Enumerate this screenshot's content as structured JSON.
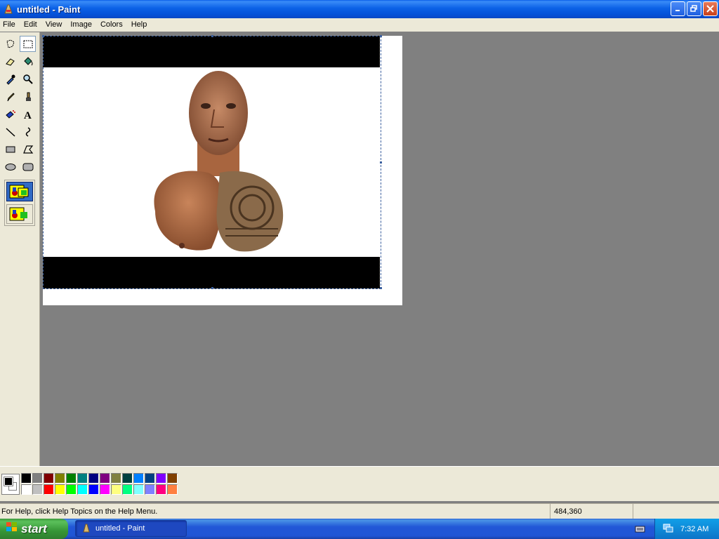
{
  "window": {
    "title": "untitled - Paint",
    "icon": "paint-icon"
  },
  "menu": [
    "File",
    "Edit",
    "View",
    "Image",
    "Colors",
    "Help"
  ],
  "tools": [
    {
      "name": "free-form-select",
      "icon": "free-select-icon"
    },
    {
      "name": "select",
      "icon": "rect-select-icon",
      "active": true
    },
    {
      "name": "eraser",
      "icon": "eraser-icon"
    },
    {
      "name": "fill-with-color",
      "icon": "fill-bucket-icon"
    },
    {
      "name": "pick-color",
      "icon": "eyedropper-icon"
    },
    {
      "name": "magnifier",
      "icon": "magnifier-icon"
    },
    {
      "name": "pencil",
      "icon": "pencil-icon"
    },
    {
      "name": "brush",
      "icon": "brush-icon"
    },
    {
      "name": "airbrush",
      "icon": "airbrush-icon"
    },
    {
      "name": "text",
      "icon": "text-icon"
    },
    {
      "name": "line",
      "icon": "line-icon"
    },
    {
      "name": "curve",
      "icon": "curve-icon"
    },
    {
      "name": "rectangle",
      "icon": "rectangle-icon"
    },
    {
      "name": "polygon",
      "icon": "polygon-icon"
    },
    {
      "name": "ellipse",
      "icon": "ellipse-icon"
    },
    {
      "name": "rounded-rectangle",
      "icon": "rounded-rect-icon"
    }
  ],
  "palette": {
    "foreground": "#000000",
    "background": "#ffffff",
    "colors": [
      "#000000",
      "#808080",
      "#800000",
      "#808000",
      "#008000",
      "#008080",
      "#000080",
      "#800080",
      "#808040",
      "#004040",
      "#0080ff",
      "#004080",
      "#8000ff",
      "#804000",
      "#ffffff",
      "#c0c0c0",
      "#ff0000",
      "#ffff00",
      "#00ff00",
      "#00ffff",
      "#0000ff",
      "#ff00ff",
      "#ffff80",
      "#00ff80",
      "#80ffff",
      "#8080ff",
      "#ff0080",
      "#ff8040"
    ]
  },
  "status": {
    "help_text": "For Help, click Help Topics on the Help Menu.",
    "coords": "484,360",
    "size": ""
  },
  "taskbar": {
    "start_label": "start",
    "task_label": "untitled - Paint",
    "clock": "7:32 AM"
  }
}
